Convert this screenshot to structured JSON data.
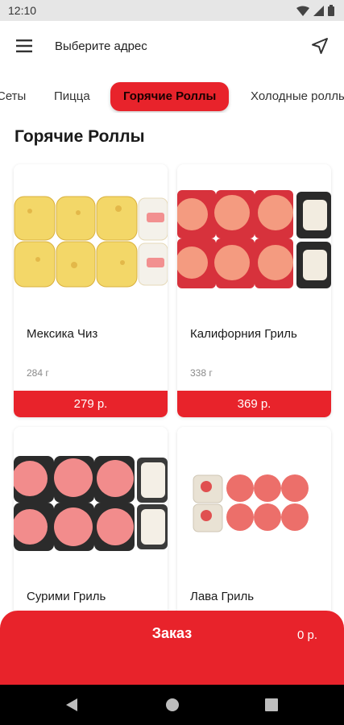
{
  "status_bar": {
    "time": "12:10",
    "icons": [
      "wifi-icon",
      "signal-icon",
      "battery-icon"
    ]
  },
  "header": {
    "address_prompt": "Выберите адрес",
    "menu_icon": "hamburger-menu-icon",
    "location_icon": "navigation-arrow-icon"
  },
  "tabs": [
    {
      "label": "Сеты",
      "active": false
    },
    {
      "label": "Пицца",
      "active": false
    },
    {
      "label": "Горячие Роллы",
      "active": true
    },
    {
      "label": "Холодные роллы",
      "active": false
    }
  ],
  "section_title": "Горячие Роллы",
  "products": [
    {
      "name": "Мексика Чиз",
      "weight": "284 г",
      "price": "279 р."
    },
    {
      "name": "Калифорния Гриль",
      "weight": "338 г",
      "price": "369 р."
    },
    {
      "name": "Сурими Гриль"
    },
    {
      "name": "Лава Гриль"
    }
  ],
  "order_bar": {
    "label": "Заказ",
    "total": "0 р."
  },
  "nav_bar": {
    "icons": [
      "back-icon",
      "home-icon",
      "recents-icon"
    ]
  },
  "colors": {
    "accent": "#e8232b",
    "status_bar_bg": "#e6e6e6",
    "nav_bar_bg": "#000000"
  }
}
